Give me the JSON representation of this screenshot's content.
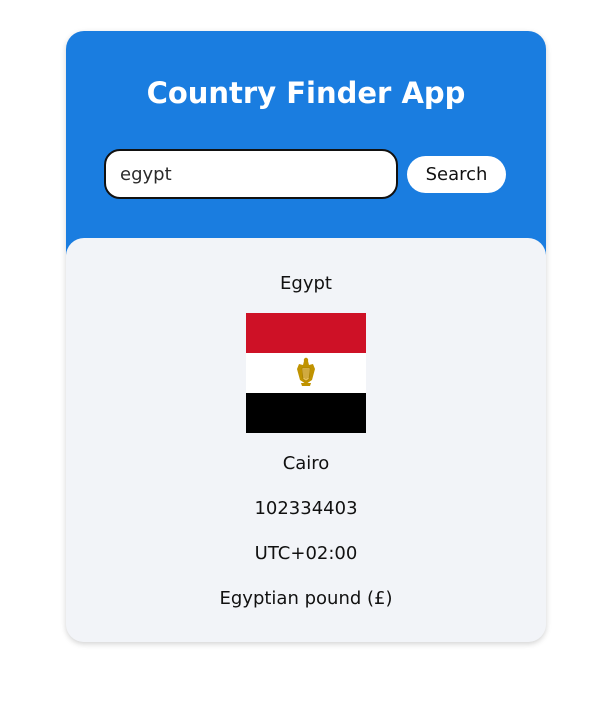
{
  "header": {
    "title": "Country Finder App",
    "search_value": "egypt",
    "search_button_label": "Search"
  },
  "result": {
    "country_name": "Egypt",
    "flag_icon": "egypt-flag",
    "capital": "Cairo",
    "population": "102334403",
    "timezone": "UTC+02:00",
    "currency": "Egyptian pound (£)"
  },
  "colors": {
    "header_blue": "#1a7de0",
    "panel_bg": "#f2f4f8",
    "flag_red": "#ce1126",
    "flag_white": "#ffffff",
    "flag_black": "#000000",
    "eagle_gold": "#c09300"
  }
}
